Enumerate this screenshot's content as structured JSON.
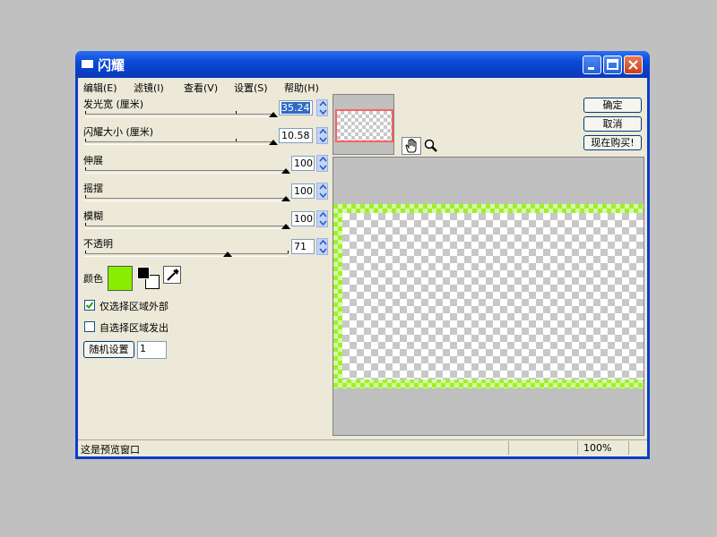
{
  "window": {
    "title": "闪耀"
  },
  "menu": [
    "编辑(E)",
    "滤镜(I)",
    "查看(V)",
    "设置(S)",
    "帮助(H)"
  ],
  "controls": {
    "glow_width": {
      "label": "发光宽 (厘米)",
      "value": "35.24",
      "slider_fraction": 0.98
    },
    "glow_size": {
      "label": "闪耀大小 (厘米)",
      "value": "10.58",
      "slider_fraction": 0.98
    },
    "stretch": {
      "label": "伸展",
      "value": "100",
      "slider_fraction": 1.0
    },
    "sway": {
      "label": "摇摆",
      "value": "100",
      "slider_fraction": 1.0
    },
    "blur": {
      "label": "模糊",
      "value": "100",
      "slider_fraction": 1.0
    },
    "opacity": {
      "label": "不透明",
      "value": "71",
      "slider_fraction": 0.71
    }
  },
  "color": {
    "label": "颜色",
    "swatch": "#88ee00"
  },
  "options": {
    "only_outside": {
      "label": "仅选择区域外部",
      "checked": true
    },
    "glow_from_selection": {
      "label": "自选择区域发出",
      "checked": false
    }
  },
  "random": {
    "button": "随机设置",
    "value": "1"
  },
  "buttons": {
    "ok": "确定",
    "cancel": "取消",
    "buy": "现在购买!"
  },
  "status": {
    "text": "这是预览窗口",
    "zoom": "100%"
  },
  "colors": {
    "glow": "#9ef02a",
    "titlebar": "#0a3fc7"
  },
  "icons": {
    "hand": "hand-icon",
    "zoom": "magnifier-icon",
    "eyedropper": "eyedropper-icon"
  }
}
